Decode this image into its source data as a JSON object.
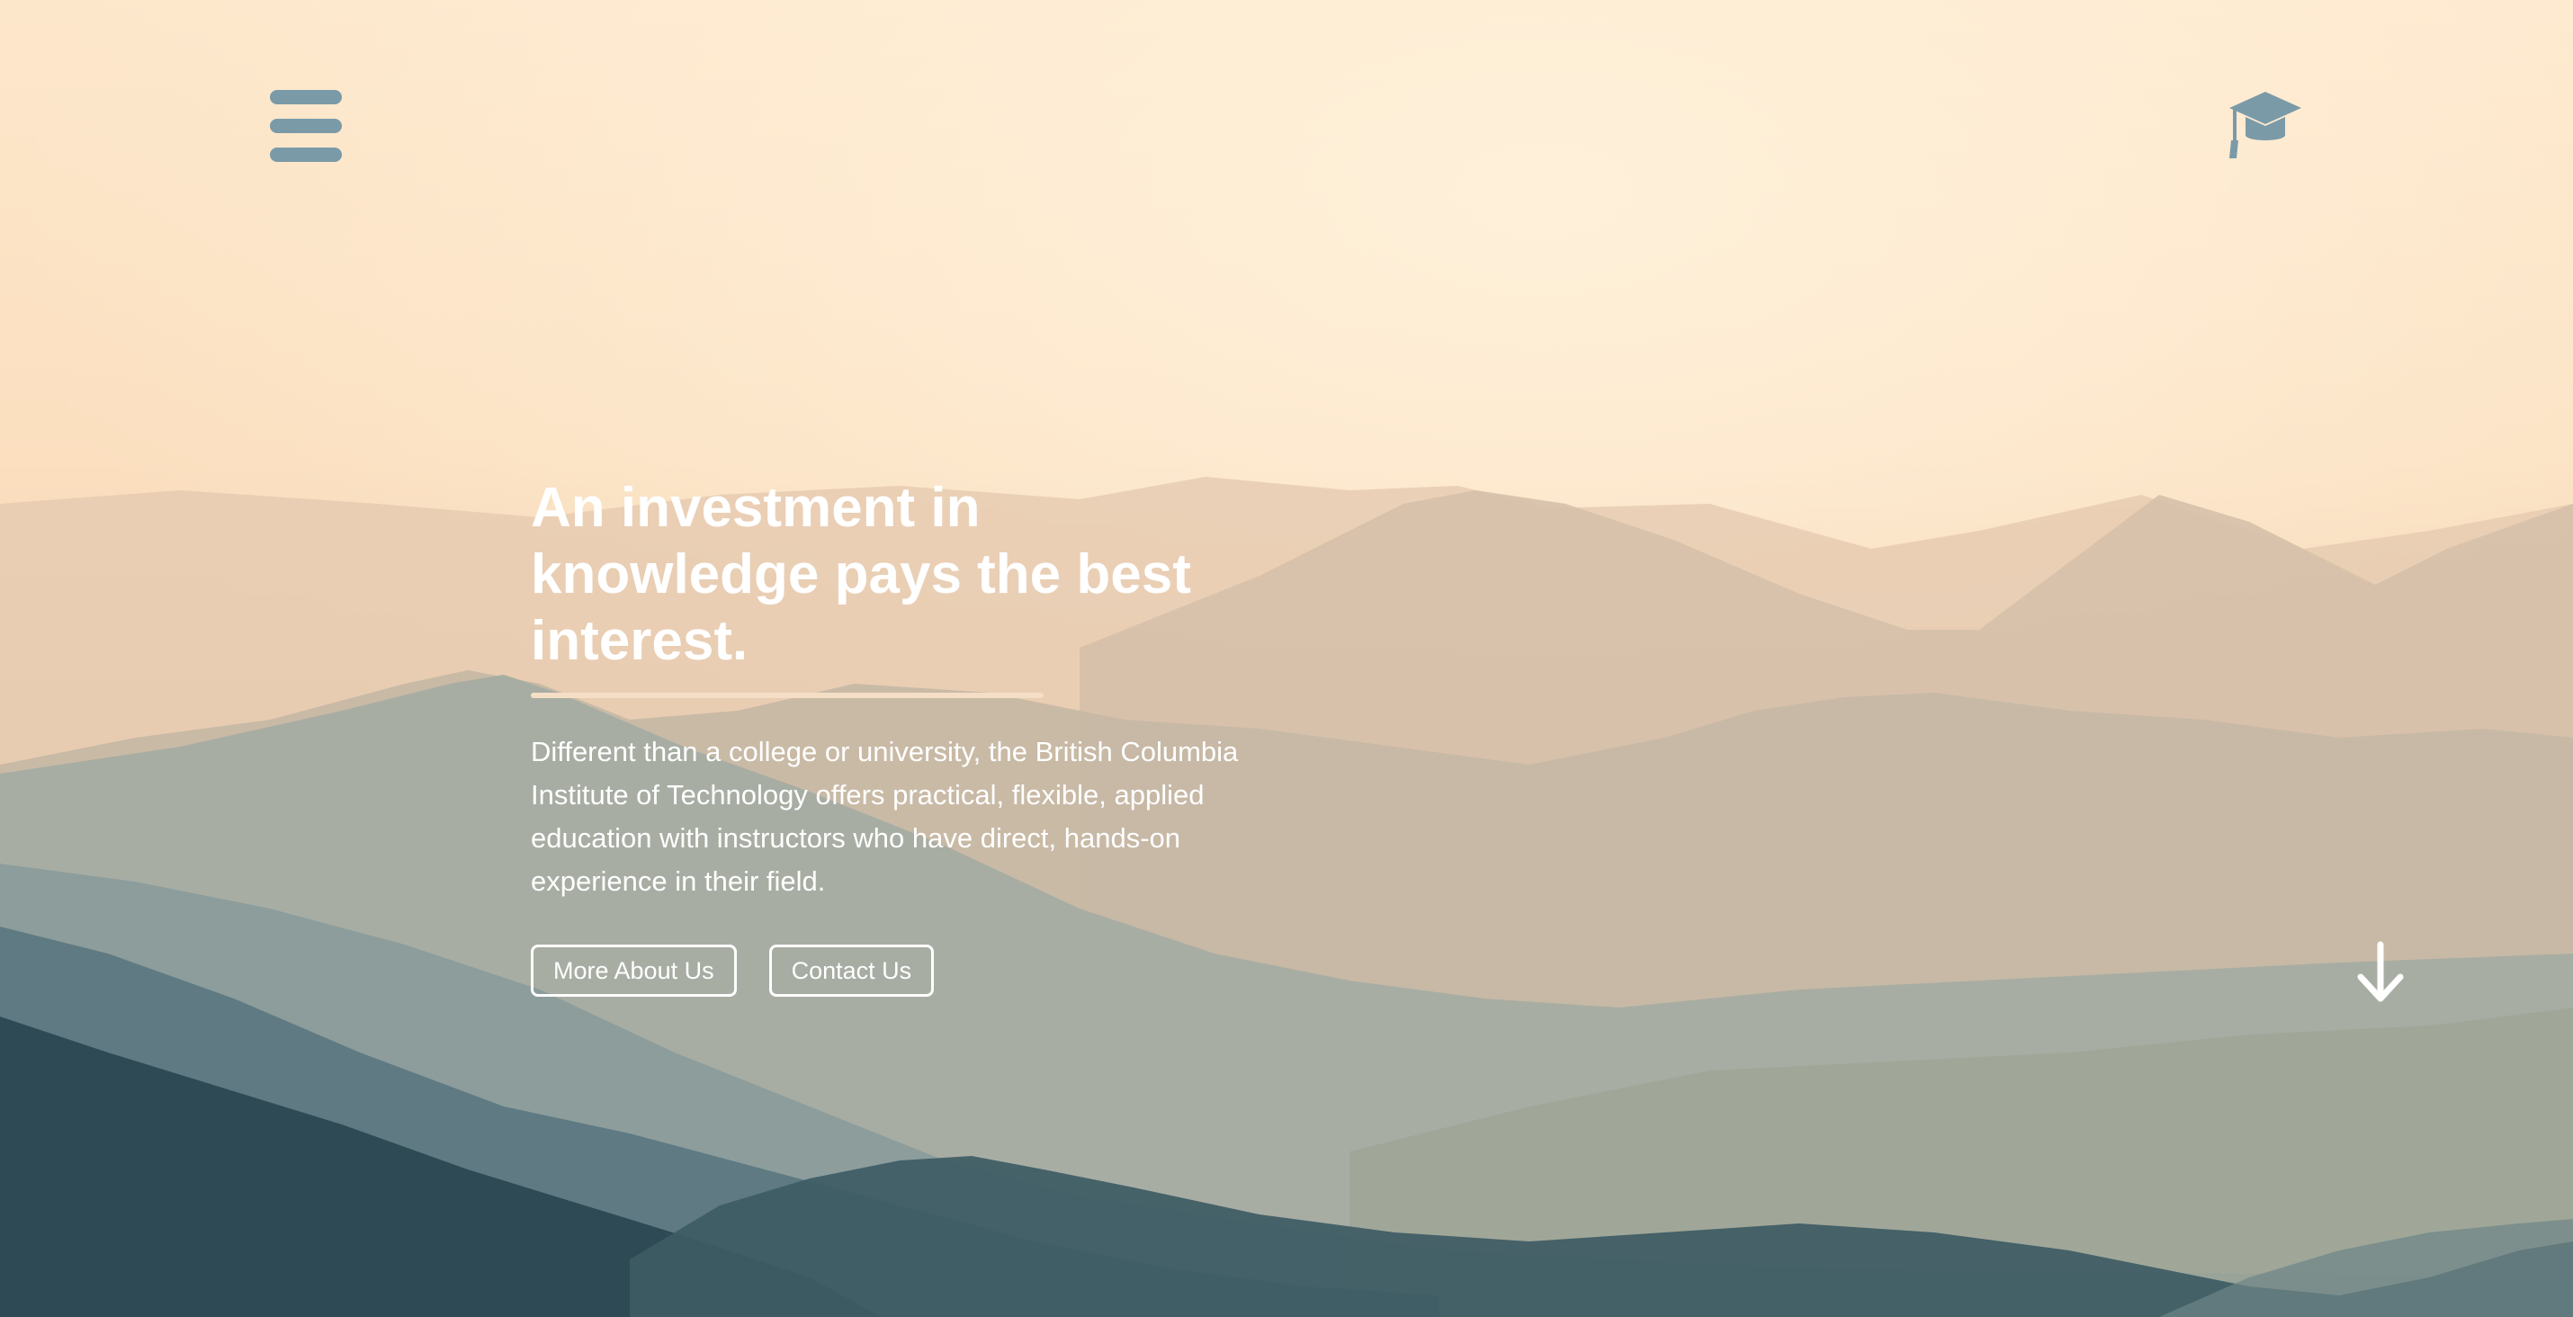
{
  "header": {
    "menu_icon": "hamburger-menu-icon",
    "logo_icon": "graduation-cap-icon"
  },
  "hero": {
    "headline": "An investment in knowledge pays the best interest.",
    "description": "Different than a college or university, the British Columbia Institute of Technology offers practical, flexible, applied education with instructors who have direct, hands-on experience in their field.",
    "buttons": {
      "more_about_us": "More About Us",
      "contact_us": "Contact Us"
    },
    "scroll_icon": "arrow-down-icon"
  },
  "colors": {
    "icon_accent": "#7b9aa8",
    "text": "#ffffff",
    "divider": "#f5dec6"
  }
}
